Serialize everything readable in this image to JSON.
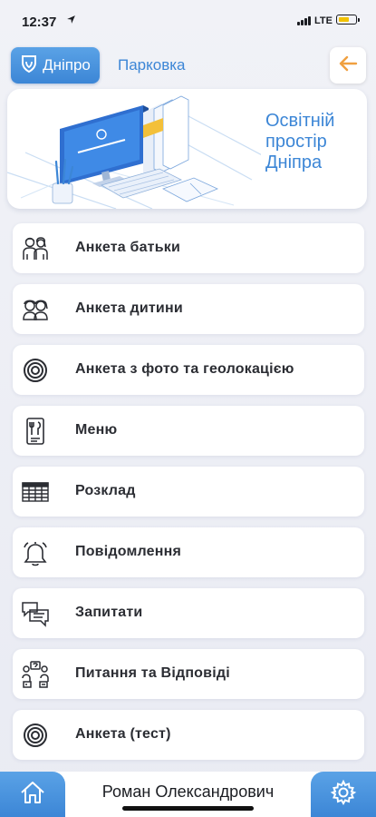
{
  "status_bar": {
    "time": "12:37",
    "location_icon": "location-arrow-icon",
    "network": "LTE",
    "battery_color": "#f2c200"
  },
  "header": {
    "logo_text": "Дніпро",
    "parking_link": "Парковка",
    "back_icon": "arrow-left-icon",
    "accent_color": "#3c86d6",
    "back_color": "#f0a040"
  },
  "banner": {
    "title_lines": [
      "Освітній",
      "простір",
      "Дніпра"
    ]
  },
  "menu": {
    "items": [
      {
        "label": "Анкета батьки",
        "icon": "parents-icon"
      },
      {
        "label": "Анкета дитини",
        "icon": "children-icon"
      },
      {
        "label": "Анкета з фото та геолокацією",
        "icon": "target-icon"
      },
      {
        "label": "Меню",
        "icon": "menu-card-icon"
      },
      {
        "label": "Розклад",
        "icon": "schedule-table-icon"
      },
      {
        "label": "Повідомлення",
        "icon": "bell-icon"
      },
      {
        "label": "Запитати",
        "icon": "chat-bubbles-icon"
      },
      {
        "label": "Питання та Відповіді",
        "icon": "faq-icon"
      },
      {
        "label": "Анкета (тест)",
        "icon": "target-icon"
      }
    ]
  },
  "bottom_bar": {
    "user_name": "Роман Олександрович",
    "home_icon": "home-icon",
    "settings_icon": "gear-icon"
  }
}
